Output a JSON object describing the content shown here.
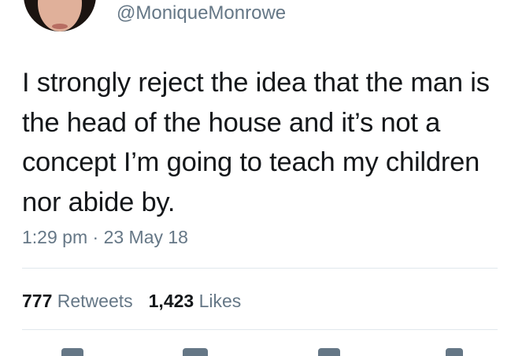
{
  "tweet": {
    "handle": "@MoniqueMonrowe",
    "text": "I strongly reject the idea that the man is the head of the house and it’s not a concept I’m going to teach my children nor abide by.",
    "time": "1:29 pm",
    "separator": "·",
    "date": "23 May 18"
  },
  "stats": {
    "retweets_count": "777",
    "retweets_label": "Retweets",
    "likes_count": "1,423",
    "likes_label": "Likes"
  },
  "actions": {
    "icons": [
      "reply-icon",
      "retweet-icon",
      "like-icon",
      "share-icon"
    ]
  },
  "colors": {
    "text": "#14171a",
    "secondary": "#657786",
    "divider": "#e1e8ed"
  }
}
